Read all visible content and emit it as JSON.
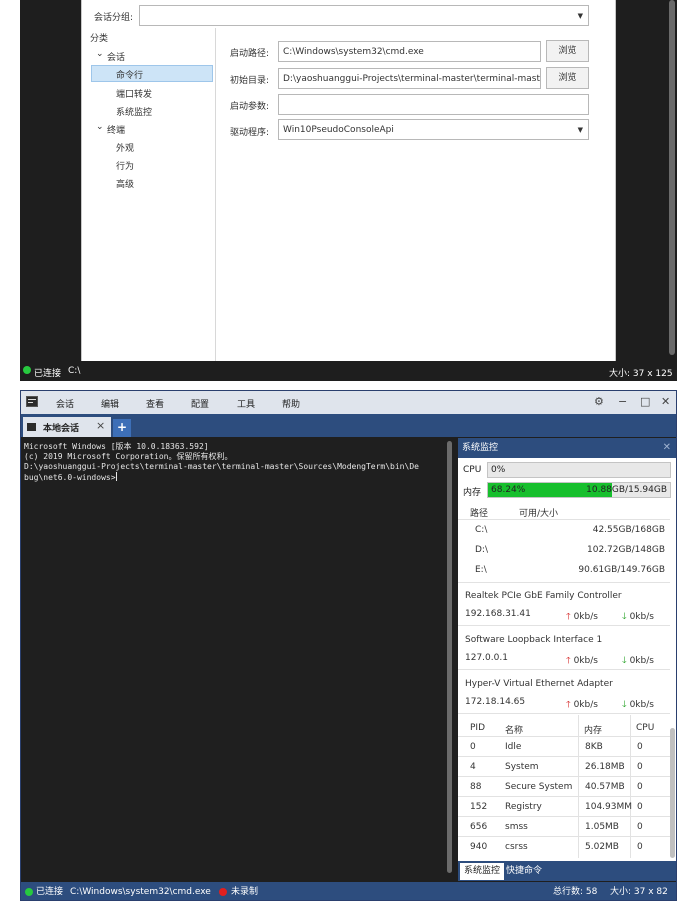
{
  "top": {
    "group_label": "会话分组:",
    "category_label": "分类",
    "tree": [
      "会话",
      "命令行",
      "端口转发",
      "系统监控",
      "终端",
      "外观",
      "行为",
      "高级"
    ],
    "tree_arrows": [
      "⌄",
      "⌄"
    ],
    "start_path_label": "启动路径:",
    "start_path": "C:\\Windows\\system32\\cmd.exe",
    "browse": "浏览",
    "init_dir_label": "初始目录:",
    "init_dir": "D:\\yaoshuanggui-Projects\\terminal-master\\terminal-master\\",
    "args_label": "启动参数:",
    "driver_label": "驱动程序:",
    "driver": "Win10PseudoConsoleApi",
    "status_connected": "已连接",
    "status_path": "C:\\",
    "status_size": "大小: 37 x 125"
  },
  "win": {
    "menus": [
      "会话",
      "编辑",
      "查看",
      "配置",
      "工具",
      "帮助"
    ],
    "tab_title": "本地会话",
    "tab_close": "×",
    "tab_add": "+",
    "controls": [
      "⚙",
      "−",
      "□",
      "✕"
    ],
    "terminal_lines": [
      "Microsoft Windows [版本 10.0.18363.592]",
      "(c) 2019 Microsoft Corporation。保留所有权利。",
      "",
      "D:\\yaoshuanggui-Projects\\terminal-master\\terminal-master\\Sources\\ModengTerm\\bin\\De",
      "bug\\net6.0-windows>"
    ]
  },
  "monitor": {
    "title": "系统监控",
    "close": "✕",
    "cpu_label": "CPU",
    "cpu_value": "0%",
    "cpu_fraction": 0,
    "mem_label": "内存",
    "mem_value": "68.24%",
    "mem_fraction": 0.6824,
    "mem_size": "10.88GB/15.94GB",
    "disk_headers": [
      "路径",
      "可用/大小"
    ],
    "disks": [
      {
        "path": "C:\\",
        "size": "42.55GB/168GB"
      },
      {
        "path": "D:\\",
        "size": "102.72GB/148GB"
      },
      {
        "path": "E:\\",
        "size": "90.61GB/149.76GB"
      }
    ],
    "nets": [
      {
        "name": "Realtek PCIe GbE Family Controller",
        "ip": "192.168.31.41",
        "up": "0kb/s",
        "down": "0kb/s"
      },
      {
        "name": "Software Loopback Interface 1",
        "ip": "127.0.0.1",
        "up": "0kb/s",
        "down": "0kb/s"
      },
      {
        "name": "Hyper-V Virtual Ethernet Adapter",
        "ip": "172.18.14.65",
        "up": "0kb/s",
        "down": "0kb/s"
      }
    ],
    "proc_headers": [
      "PID",
      "名称",
      "内存",
      "CPU"
    ],
    "procs": [
      {
        "pid": "0",
        "name": "Idle",
        "mem": "8KB",
        "cpu": "0"
      },
      {
        "pid": "4",
        "name": "System",
        "mem": "26.18MB",
        "cpu": "0"
      },
      {
        "pid": "88",
        "name": "Secure System",
        "mem": "40.57MB",
        "cpu": "0"
      },
      {
        "pid": "152",
        "name": "Registry",
        "mem": "104.93MM",
        "cpu": "0"
      },
      {
        "pid": "656",
        "name": "smss",
        "mem": "1.05MB",
        "cpu": "0"
      },
      {
        "pid": "940",
        "name": "csrss",
        "mem": "5.02MB",
        "cpu": "0"
      }
    ],
    "tabs": [
      "系统监控",
      "快捷命令"
    ]
  },
  "status": {
    "connected": "已连接",
    "path": "C:\\Windows\\system32\\cmd.exe",
    "recording": "未录制",
    "lines": "总行数: 58",
    "size": "大小: 37 x 82"
  },
  "colors": {
    "accent": "#2d4d7e",
    "connected_dot": "#27c93f",
    "record_dot": "#e02020",
    "mem_bar": "#17bf2d"
  }
}
